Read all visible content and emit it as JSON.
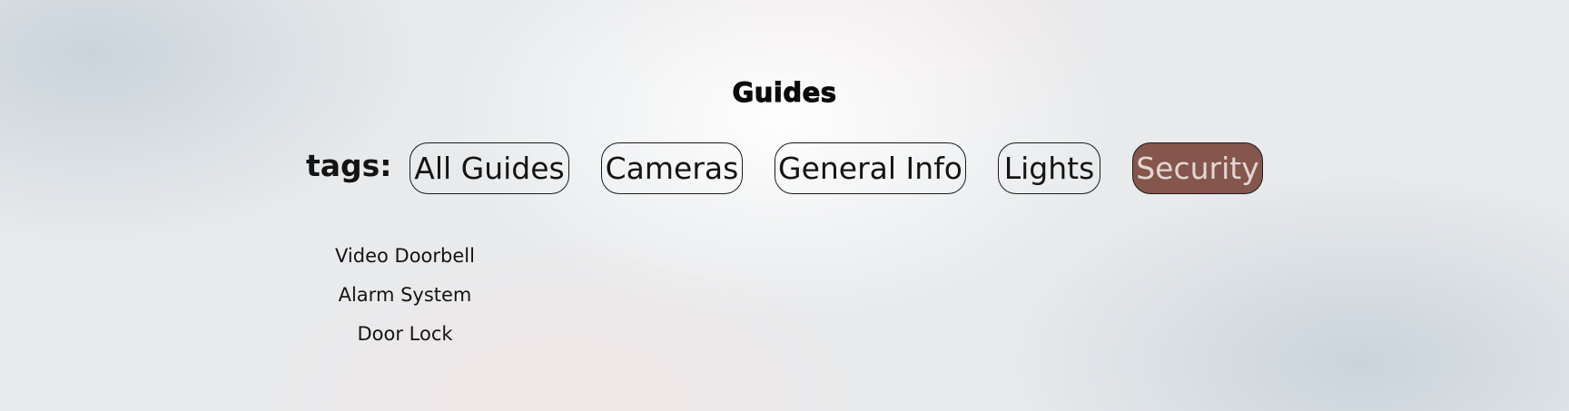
{
  "page": {
    "title": "Guides",
    "tags_label": "tags:"
  },
  "tags": [
    {
      "label": "All Guides",
      "active": false
    },
    {
      "label": "Cameras",
      "active": false
    },
    {
      "label": "General Info",
      "active": false
    },
    {
      "label": "Lights",
      "active": false
    },
    {
      "label": "Security",
      "active": true
    }
  ],
  "guides": [
    {
      "label": "Video Doorbell"
    },
    {
      "label": "Alarm System"
    },
    {
      "label": "Door Lock"
    }
  ],
  "colors": {
    "active_tag_bg": "#85564c",
    "active_tag_text": "#e3d6d3",
    "text": "#141414"
  }
}
